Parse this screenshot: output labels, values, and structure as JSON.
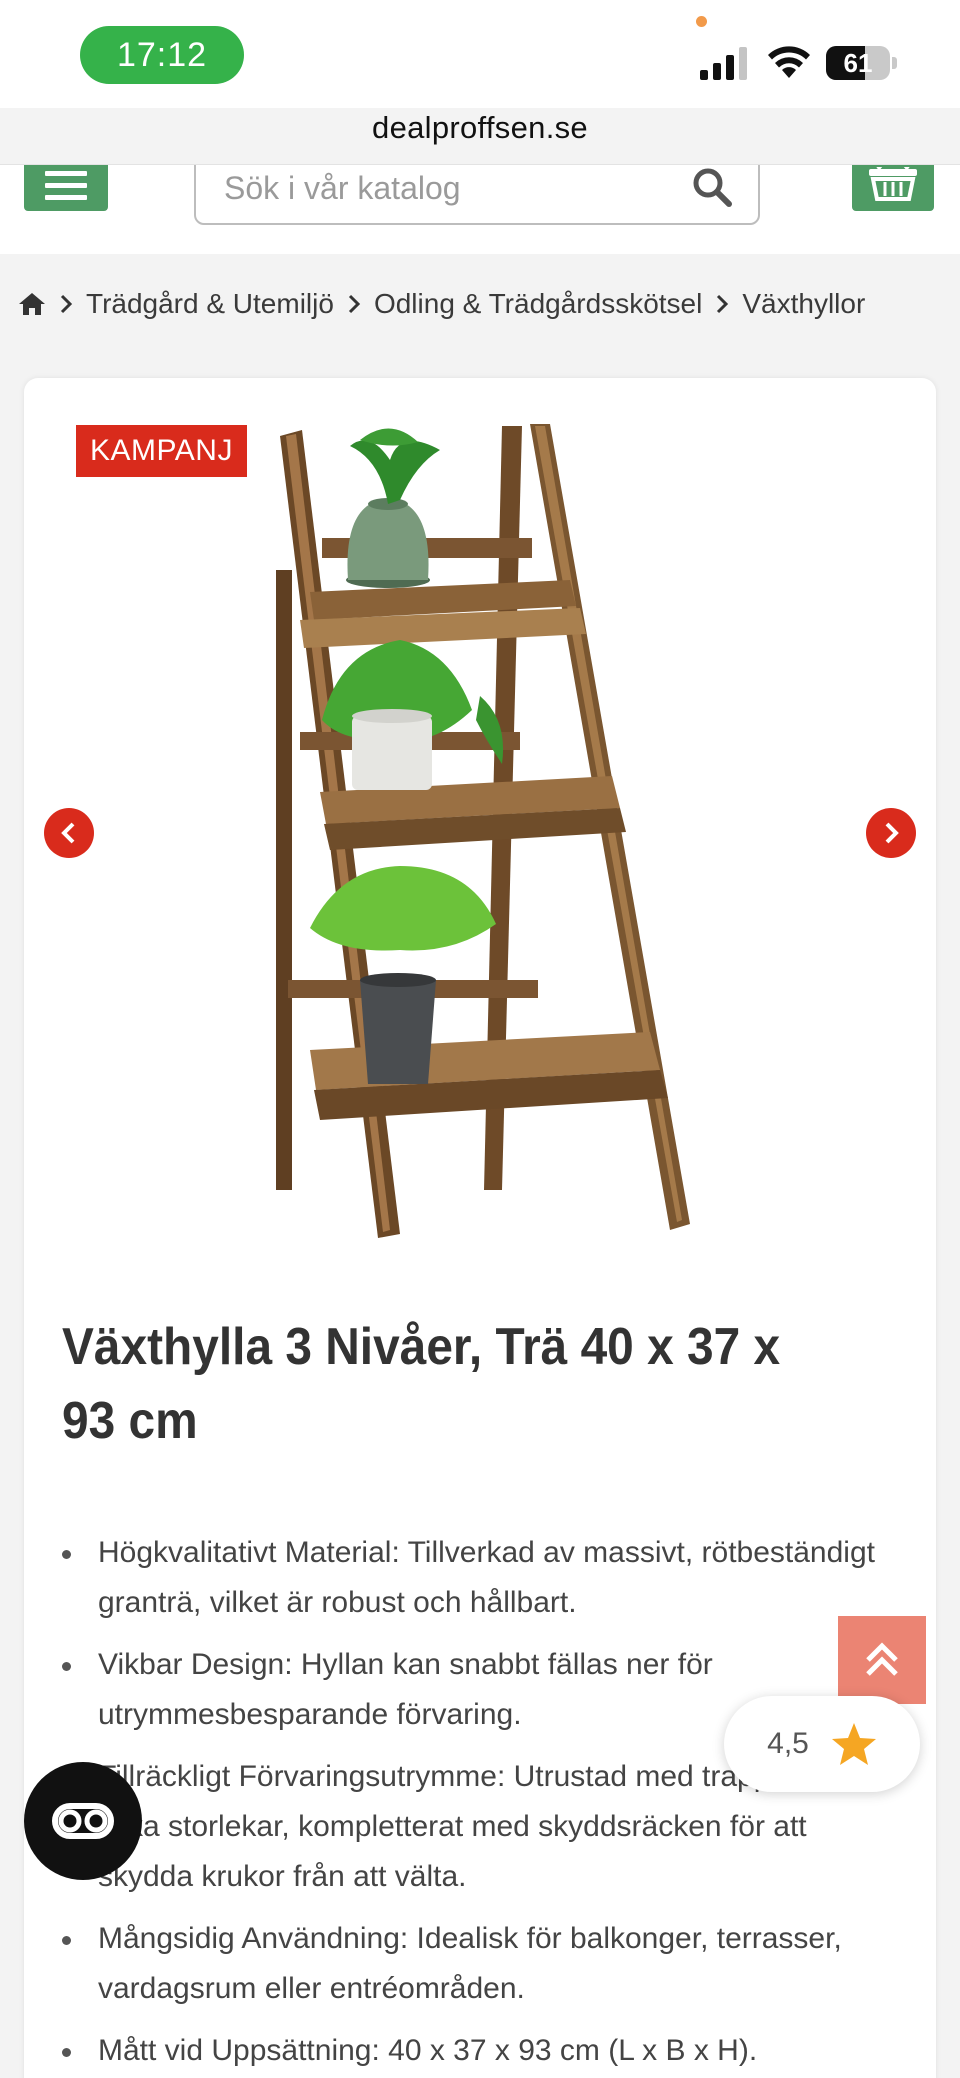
{
  "status_bar": {
    "time": "17:12",
    "battery": "61",
    "battery_level": 0.61
  },
  "browser": {
    "url": "dealproffsen.se"
  },
  "header": {
    "search_placeholder": "Sök i vår katalog"
  },
  "breadcrumb": [
    "Trädgård & Utemiljö",
    "Odling & Trädgårdsskötsel",
    "Växthyllor"
  ],
  "product": {
    "badge": "KAMPANJ",
    "title": "Växthylla 3 Nivåer, Trä 40 x 37 x 93 cm",
    "features": [
      "Högkvalitativt Material: Tillverkad av massivt, rötbeständigt granträ, vilket är robust och hållbart.",
      "Vikbar Design: Hyllan kan snabbt fällas ner för utrymmesbesparande förvaring.",
      "Tillräckligt Förvaringsutrymme: Utrustad med trappsteg i olika storlekar, kompletterat med skyddsräcken för att skydda krukor från att välta.",
      "Mångsidig Användning: Idealisk för balkonger, terrasser, vardagsrum eller entréområden.",
      "Mått vid Uppsättning: 40 x 37 x 93 cm (L x B x H)."
    ]
  },
  "rating": {
    "value": "4,5"
  },
  "colors": {
    "brand_green": "#4e9b64",
    "sale_red": "#d92b1c",
    "status_green": "#35b24a",
    "star": "#f5a623"
  },
  "icons": [
    "menu-icon",
    "search-icon",
    "basket-icon",
    "home-icon",
    "chevron-right-icon",
    "chevron-left-icon",
    "double-chevron-up-icon",
    "star-icon",
    "cookie-settings-icon"
  ]
}
